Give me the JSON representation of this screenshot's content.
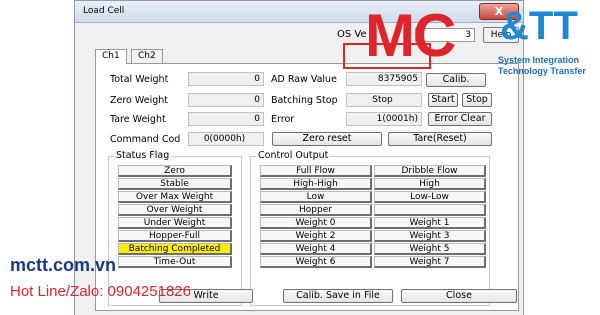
{
  "window": {
    "title": "Load Cell",
    "close_label": "X"
  },
  "header": {
    "os_label": "OS Ve",
    "os_value": "3",
    "help_label": "Help"
  },
  "tabs": [
    {
      "label": "Ch1"
    },
    {
      "label": "Ch2"
    }
  ],
  "fields": {
    "total_weight": {
      "label": "Total Weight",
      "value": "0"
    },
    "zero_weight": {
      "label": "Zero Weight",
      "value": "0"
    },
    "tare_weight": {
      "label": "Tare Weight",
      "value": "0"
    },
    "command_code": {
      "label": "Command Cod",
      "value": "0(0000h)"
    },
    "ad_raw": {
      "label": "AD Raw Value",
      "value": "8375905"
    },
    "batching_stop": {
      "label": "Batching Stop",
      "value": "Stop"
    },
    "error": {
      "label": "Error",
      "value": "1(0001h)"
    }
  },
  "buttons": {
    "calib": "Calib.",
    "start": "Start",
    "stop": "Stop",
    "error_clear": "Error Clear",
    "zero_reset": "Zero reset",
    "tare_reset": "Tare(Reset)",
    "write": "Write",
    "calib_save": "Calib. Save in File",
    "close": "Close"
  },
  "status_flag": {
    "title": "Status Flag",
    "items": [
      "Zero",
      "Stable",
      "Over Max Weight",
      "Over Weight",
      "Under Weight",
      "Hopper-Full",
      "Batching Completed",
      "Time-Out"
    ],
    "highlight_color": "#ffee00"
  },
  "control_output": {
    "title": "Control Output",
    "left": [
      "Full Flow",
      "High-High",
      "Low",
      "Hopper",
      "Weight 0",
      "Weight 2",
      "Weight 4",
      "Weight 6"
    ],
    "right": [
      "Dribble Flow",
      "High",
      "Low-Low",
      "",
      "Weight 1",
      "Weight 3",
      "Weight 5",
      "Weight 7"
    ]
  },
  "logo": {
    "main": "MC",
    "amp": "&TT",
    "tagline1": "System Integration",
    "tagline2": "Technology Transfer"
  },
  "watermark": {
    "site": "mctt.com.vn",
    "hotline": "Hot Line/Zalo: 0904251826"
  },
  "colors": {
    "accent_red": "#e0242b",
    "accent_blue": "#1e88d2"
  }
}
